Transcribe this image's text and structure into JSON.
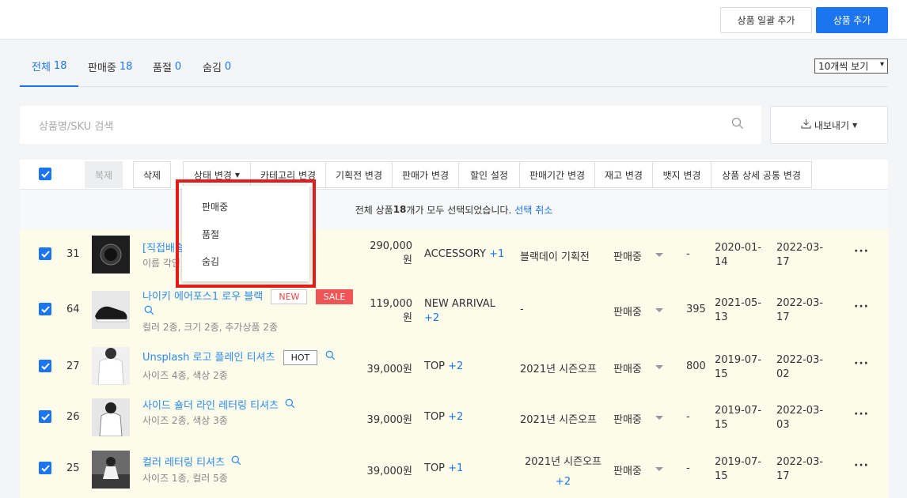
{
  "header": {
    "bulk_add_label": "상품 일괄 추가",
    "add_label": "상품 추가"
  },
  "tabs": [
    {
      "label": "전체",
      "count": "18"
    },
    {
      "label": "판매중",
      "count": "18"
    },
    {
      "label": "품절",
      "count": "0"
    },
    {
      "label": "숨김",
      "count": "0"
    }
  ],
  "view_select": "10개씩 보기",
  "search": {
    "placeholder": "상품명/SKU 검색"
  },
  "export_label": "내보내기",
  "toolbar": {
    "copy": "복제",
    "delete": "삭제",
    "status_change": "상태 변경",
    "category_change": "카테고리 변경",
    "promotion_change": "기획전 변경",
    "price_change": "판매가 변경",
    "discount": "할인 설정",
    "period_change": "판매기간 변경",
    "stock_change": "재고 변경",
    "badge_change": "뱃지 변경",
    "detail_change": "상품 상세 공통 변경"
  },
  "notice": {
    "prefix": "전체 상품 ",
    "count": "18",
    "suffix": "개가 모두 선택되었습니다.",
    "cancel": "선택 취소"
  },
  "status_menu": [
    "판매중",
    "품절",
    "숨김"
  ],
  "colors": {
    "accent": "#1b74f0",
    "row_bg": "#fdfbea",
    "highlight": "#e31b1b"
  },
  "rows": [
    {
      "id": "31",
      "name": "[직접배송]",
      "options": "이름 각인",
      "price1": "290,000",
      "price2": "원",
      "category": "ACCESSORY",
      "cat_plus": "+1",
      "promo": "블랙데이 기획전",
      "status": "판매중",
      "stock": "-",
      "date1a": "2020-01-",
      "date1b": "14",
      "date2a": "2022-03-",
      "date2b": "17"
    },
    {
      "id": "64",
      "name": "나이키 에어포스1 로우 블랙",
      "badge_new": "NEW",
      "badge_sale": "SALE",
      "options": "컬러 2종, 크기 2종, 추가상품 2종",
      "price1": "119,000",
      "price2": "원",
      "category": "NEW ARRIVAL",
      "cat_plus": "+2",
      "promo": "-",
      "status": "판매중",
      "stock": "395",
      "date1a": "2021-05-",
      "date1b": "13",
      "date2a": "2022-03-",
      "date2b": "17"
    },
    {
      "id": "27",
      "name": "Unsplash 로고 플레인 티셔츠",
      "badge_hot": "HOT",
      "options": "사이즈 4종, 색상 2종",
      "price": "39,000원",
      "category": "TOP",
      "cat_plus": "+2",
      "promo": "2021년 시즌오프",
      "status": "판매중",
      "stock": "800",
      "date1a": "2019-07-",
      "date1b": "15",
      "date2a": "2022-03-",
      "date2b": "02"
    },
    {
      "id": "26",
      "name": "사이드 숄더 라인 레터링 티셔츠",
      "options": "사이즈 2종, 색상 3종",
      "price": "39,000원",
      "category": "TOP",
      "cat_plus": "+2",
      "promo": "2021년 시즌오프",
      "status": "판매중",
      "stock": "-",
      "date1a": "2019-07-",
      "date1b": "15",
      "date2a": "2022-03-",
      "date2b": "03"
    },
    {
      "id": "25",
      "name": "컬러 레터링 티셔츠",
      "options": "사이즈 1종, 컬러 5종",
      "price": "39,000원",
      "category": "TOP",
      "cat_plus": "+1",
      "promo": "2021년 시즌오프",
      "promo_plus": "+2",
      "status": "판매중",
      "stock": "-",
      "date1a": "2019-07-",
      "date1b": "15",
      "date2a": "2022-03-",
      "date2b": "17"
    }
  ]
}
